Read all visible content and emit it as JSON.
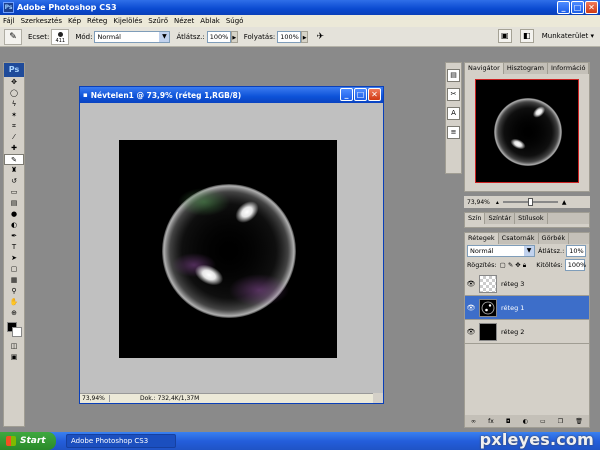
{
  "app": {
    "title": "Adobe Photoshop CS3",
    "ps_badge": "Ps",
    "window_buttons": [
      "_",
      "□",
      "✕"
    ]
  },
  "menu": [
    "Fájl",
    "Szerkesztés",
    "Kép",
    "Réteg",
    "Kijelölés",
    "Szűrő",
    "Nézet",
    "Ablak",
    "Súgó"
  ],
  "options": {
    "brush_label": "Ecset:",
    "brush_size": "411",
    "mode_label": "Mód:",
    "mode_value": "Normál",
    "opacity_label": "Átlátsz.:",
    "opacity_value": "100%",
    "flow_label": "Folyatás:",
    "flow_value": "100%",
    "workspace": "Munkaterület ▾"
  },
  "document": {
    "title": "Névtelen1 @ 73,9% (réteg 1,RGB/8)",
    "zoom": "73,94%",
    "info": "Dok.: 732,4K/1,37M"
  },
  "navigator": {
    "tabs": [
      "Navigátor",
      "Hisztogram",
      "Információ"
    ],
    "zoom": "73,94%"
  },
  "color_panel": {
    "tabs": [
      "Szín",
      "Színtár",
      "Stílusok"
    ]
  },
  "layers": {
    "tabs": [
      "Rétegek",
      "Csatornák",
      "Görbék"
    ],
    "blend_mode": "Normál",
    "opacity_label": "Átlátsz.:",
    "opacity_value": "10%",
    "lock_label": "Rögzítés:",
    "fill_label": "Kitöltés:",
    "fill_value": "100%",
    "items": [
      {
        "name": "réteg 3",
        "thumb": "check",
        "active": false
      },
      {
        "name": "réteg 1",
        "thumb": "bubble",
        "active": true
      },
      {
        "name": "réteg 2",
        "thumb": "black",
        "active": false
      }
    ]
  },
  "taskbar": {
    "start": "Start",
    "task": "Adobe Photoshop CS3"
  },
  "watermark": "pxleyes.com",
  "colors": {
    "xp_blue": "#0a4ad0",
    "layer_active": "#3d6ec9",
    "ps_blue": "#1f4b9a"
  }
}
